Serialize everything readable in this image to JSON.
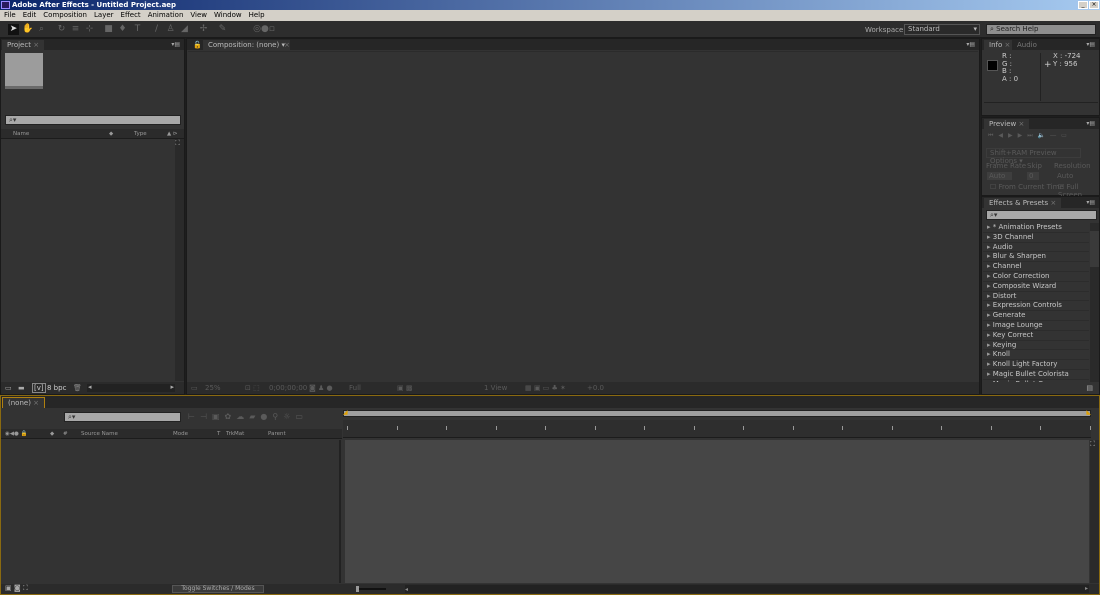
{
  "window": {
    "title": "Adobe After Effects - Untitled Project.aep",
    "logo": "Ae"
  },
  "menu": [
    "File",
    "Edit",
    "Composition",
    "Layer",
    "Effect",
    "Animation",
    "View",
    "Window",
    "Help"
  ],
  "toolbar": {
    "workspace_label": "Workspace:",
    "workspace_value": "Standard",
    "search_help_placeholder": "Search Help"
  },
  "project": {
    "tab": "Project",
    "columns": {
      "name": "Name",
      "type": "Type"
    },
    "bpc": "8 bpc",
    "search_glyph": "⌕▾"
  },
  "composition": {
    "tab": "Composition: (none)",
    "zoom": "25%",
    "timecode": "0;00;00;00",
    "resolution": "Full",
    "views": "1 View",
    "exposure": "+0.0"
  },
  "info": {
    "tab": "Info",
    "tab2": "Audio",
    "r": "R :",
    "g": "G :",
    "b": "B :",
    "a": "A : 0",
    "x": "X : -724",
    "y": "Y : 956"
  },
  "preview": {
    "tab": "Preview",
    "ram_options": "Shift+RAM Preview Options",
    "frame_rate_label": "Frame Rate",
    "skip_label": "Skip",
    "resolution_label": "Resolution",
    "frame_rate": "Auto",
    "skip": "0",
    "resolution": "Auto",
    "from_current": "From Current Time",
    "full_screen": "Full Screen"
  },
  "effects": {
    "tab": "Effects & Presets",
    "items": [
      "* Animation Presets",
      "3D Channel",
      "Audio",
      "Blur & Sharpen",
      "Channel",
      "Color Correction",
      "Composite Wizard",
      "Distort",
      "Expression Controls",
      "Generate",
      "Image Lounge",
      "Key Correct",
      "Keying",
      "Knoll",
      "Knoll Light Factory",
      "Magic Bullet Colorista",
      "Magic Bullet Cosmo"
    ]
  },
  "timeline": {
    "tab": "(none)",
    "columns": {
      "num": "#",
      "source": "Source Name",
      "mode": "Mode",
      "t": "T",
      "trkmat": "TrkMat",
      "parent": "Parent"
    },
    "toggle": "Toggle Switches / Modes"
  },
  "colors": {
    "accent": "#e0a000",
    "panel": "#333333"
  }
}
